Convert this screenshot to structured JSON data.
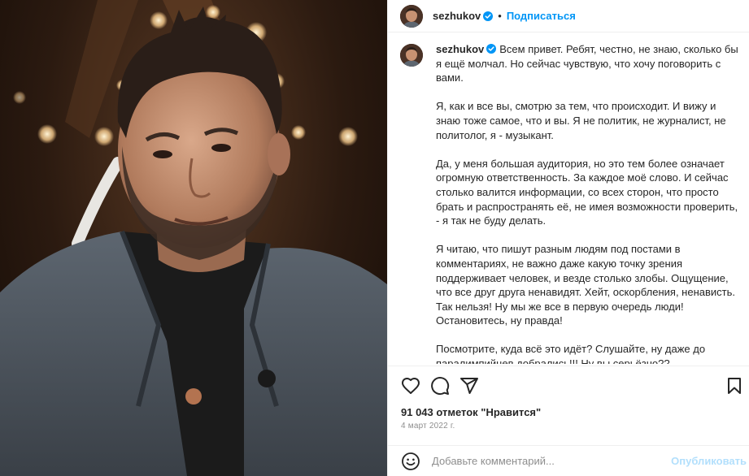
{
  "post": {
    "username": "sezhukov",
    "follow_label": "Подписаться",
    "dot": "•",
    "photo_icon": "portrait-photo",
    "caption": [
      "Всем привет. Ребят, честно, не знаю, сколько бы я ещё молчал. Но сейчас чувствую, что хочу поговорить с вами.",
      "Я, как и все вы, смотрю за тем, что происходит. И вижу и знаю тоже самое, что и вы. Я не политик, не журналист, не политолог, я - музыкант.",
      "Да, у меня большая аудитория, но это тем более означает огромную ответственность. За каждое моё слово. И сейчас столько валится информации, со всех сторон, что просто брать и распространять её, не имея возможности проверить, - я так не буду делать.",
      "Я читаю, что пишут разным людям под постами в комментариях, не важно даже какую точку зрения поддерживает человек, и везде столько злобы. Ощущение, что все друг друга ненавидят. Хейт, оскорбления, ненависть. Так нельзя! Ну мы же все в первую очередь люди! Остановитесь, ну правда!",
      "Посмотрите, куда всё это идёт? Слушайте, ну даже до паралимпийцев добрались!!! Ну вы серьёзно??"
    ],
    "likes": "91 043 отметок \"Нравится\"",
    "date": "4 март 2022 г."
  },
  "actions": {
    "like_icon": "heart-icon",
    "comment_icon": "comment-icon",
    "share_icon": "paper-plane-icon",
    "save_icon": "bookmark-icon"
  },
  "comment": {
    "placeholder": "Добавьте комментарий...",
    "post_label": "Опубликовать",
    "emoji_icon": "smiley-icon"
  },
  "colors": {
    "accent": "#0095f6",
    "verified": "#0095f6",
    "muted": "#8e8e8e",
    "post_disabled": "#b2dffc"
  }
}
